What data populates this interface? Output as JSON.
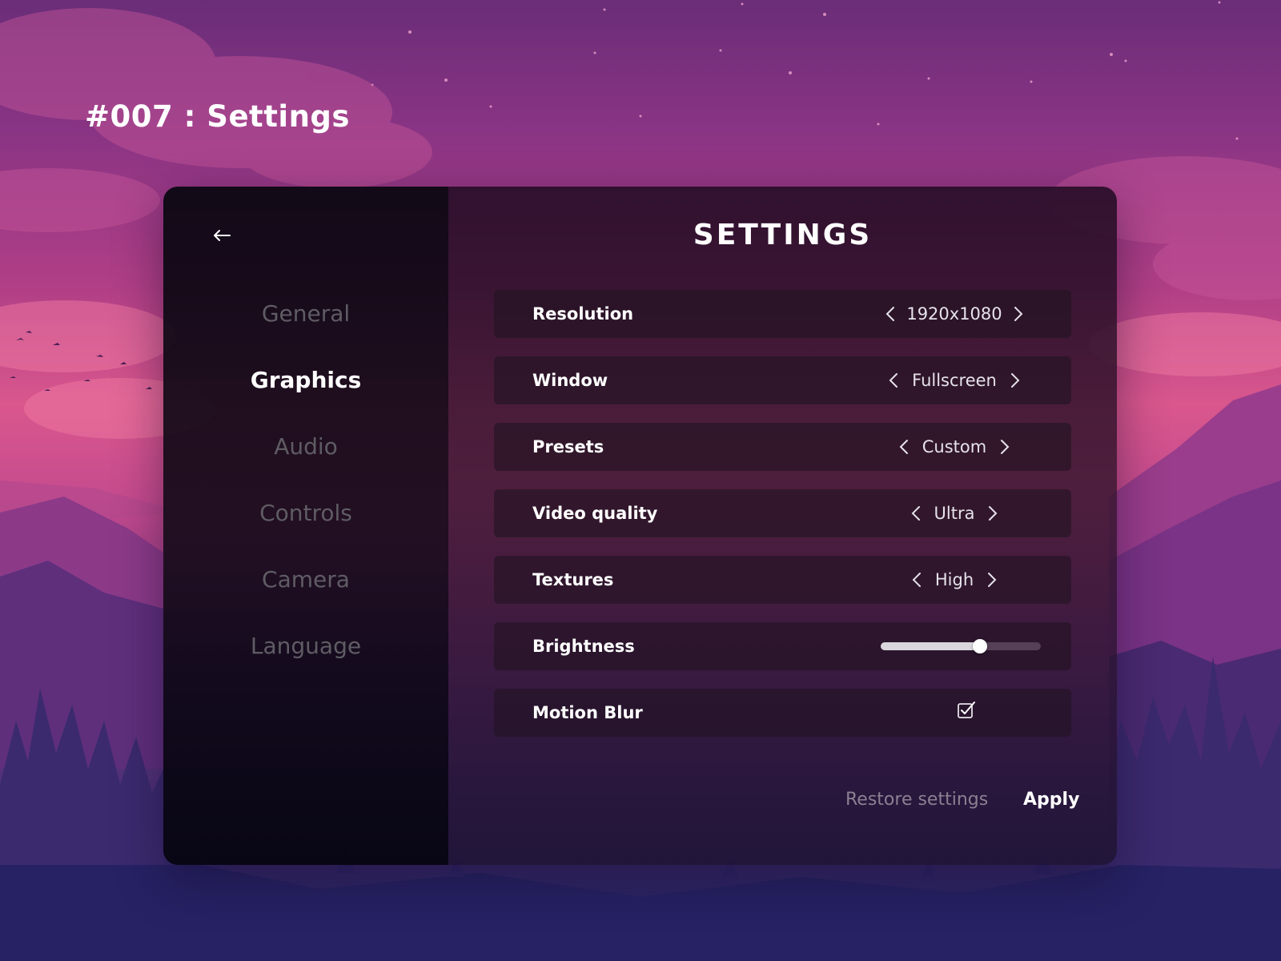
{
  "page_title": "#007 : Settings",
  "sidebar": {
    "back_icon": "arrow-left-icon",
    "items": [
      {
        "label": "General",
        "active": false
      },
      {
        "label": "Graphics",
        "active": true
      },
      {
        "label": "Audio",
        "active": false
      },
      {
        "label": "Controls",
        "active": false
      },
      {
        "label": "Camera",
        "active": false
      },
      {
        "label": "Language",
        "active": false
      }
    ]
  },
  "main": {
    "title": "SETTINGS",
    "settings": [
      {
        "label": "Resolution",
        "type": "selector",
        "value": "1920x1080"
      },
      {
        "label": "Window",
        "type": "selector",
        "value": "Fullscreen"
      },
      {
        "label": "Presets",
        "type": "selector",
        "value": "Custom"
      },
      {
        "label": "Video quality",
        "type": "selector",
        "value": "Ultra"
      },
      {
        "label": "Textures",
        "type": "selector",
        "value": "High"
      },
      {
        "label": "Brightness",
        "type": "slider",
        "value": 0.62
      },
      {
        "label": "Motion Blur",
        "type": "checkbox",
        "checked": true
      }
    ],
    "restore_label": "Restore settings",
    "apply_label": "Apply"
  },
  "colors": {
    "accent": "#ffffff",
    "muted_nav": "#5f5c64",
    "restore_text": "#8d7f92",
    "sky_pink": "#d9578d",
    "sky_purple": "#6a2d78",
    "mountain_navy": "#252262"
  }
}
